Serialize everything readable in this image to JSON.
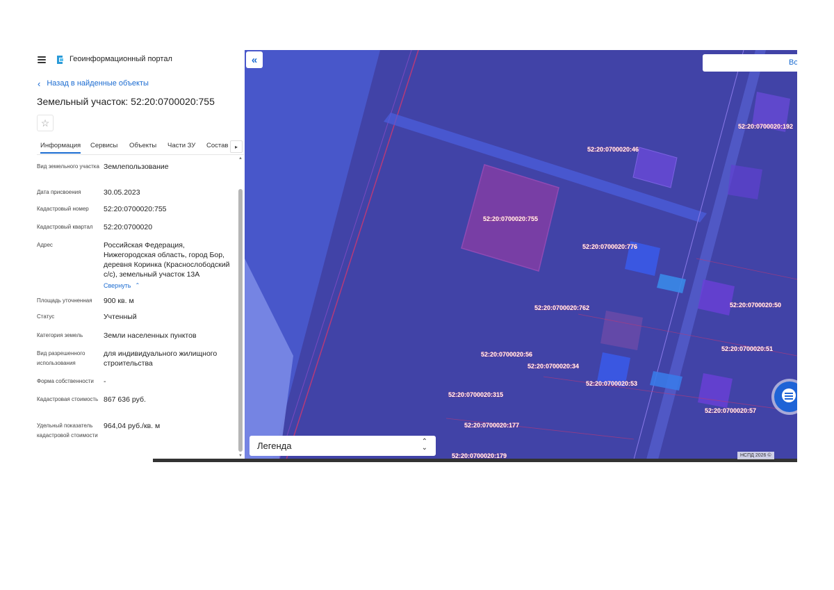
{
  "header": {
    "title": "Геоинформационный портал"
  },
  "back_link": "Назад в найденные объекты",
  "page_title": "Земельный участок: 52:20:0700020:755",
  "tabs": [
    "Информация",
    "Сервисы",
    "Объекты",
    "Части ЗУ",
    "Состав"
  ],
  "info": {
    "land_type": {
      "label": "Вид земельного участка",
      "value": "Землепользование"
    },
    "assign_date": {
      "label": "Дата присвоения",
      "value": "30.05.2023"
    },
    "cadastral_number": {
      "label": "Кадастровый номер",
      "value": "52:20:0700020:755"
    },
    "cadastral_quarter": {
      "label": "Кадастровый квартал",
      "value": "52:20:0700020"
    },
    "address": {
      "label": "Адрес",
      "value": "Российская Федерация, Нижегородская область, город Бор, деревня Коринка (Краснослободский с/с), земельный участок 13А",
      "collapse": "Свернуть"
    },
    "area": {
      "label": "Площадь уточненная",
      "value": "900 кв. м"
    },
    "status": {
      "label": "Статус",
      "value": "Учтенный"
    },
    "category": {
      "label": "Категория земель",
      "value": "Земли населенных пунктов"
    },
    "permitted_use": {
      "label": "Вид разрешенного использования",
      "value": "для индивидуального жилищного строительства"
    },
    "ownership": {
      "label": "Форма собственности",
      "value": "-"
    },
    "cadastral_value": {
      "label": "Кадастровая стоимость",
      "value": "867 636 руб."
    },
    "specific_value": {
      "label": "Удельный показатель кадастровой стоимости",
      "value": "964,04 руб./кв. м"
    }
  },
  "map": {
    "search_text": "Во",
    "legend_label": "Легенда",
    "copyright": "НСПД 2026 ©",
    "parcel_labels": [
      "52:20:0700020:192",
      "52:20:0700020:46",
      "52:20:0700020:755",
      "52:20:0700020:776",
      "52:20:0700020:762",
      "52:20:0700020:56",
      "52:20:0700020:34",
      "52:20:0700020:53",
      "52:20:0700020:315",
      "52:20:0700020:177",
      "52:20:0700020:179",
      "52:20:0700020:50",
      "52:20:0700020:51",
      "52:20:0700020:57"
    ]
  },
  "colors": {
    "accent": "#1a6bd1",
    "map_overlay": "#3a3fb0",
    "selected_parcel": "#b03aa8"
  },
  "icons": {
    "menu": "menu-icon",
    "logo": "logo-icon",
    "back": "chevron-left-icon",
    "favorite": "star-icon",
    "chat": "chat-icon"
  }
}
